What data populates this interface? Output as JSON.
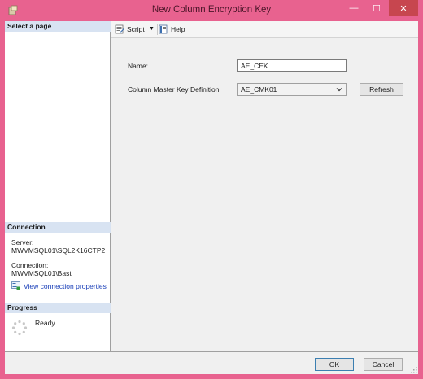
{
  "window": {
    "title": "New Column Encryption Key",
    "minimize_glyph": "—",
    "maximize_glyph": "☐",
    "close_glyph": "✕"
  },
  "left": {
    "select_page_label": "Select a page",
    "connection_label": "Connection",
    "server_label": "Server:",
    "server_value": "MWVMSQL01\\SQL2K16CTP2",
    "connection_field_label": "Connection:",
    "connection_value": "MWVMSQL01\\Bast",
    "view_properties_link": "View connection properties",
    "progress_label": "Progress",
    "progress_status": "Ready"
  },
  "toolbar": {
    "script_label": "Script",
    "dropdown_glyph": "▼",
    "help_label": "Help"
  },
  "form": {
    "name_label": "Name:",
    "name_value": "AE_CEK",
    "cmk_label": "Column Master Key Definition:",
    "cmk_selected": "AE_CMK01",
    "refresh_label": "Refresh"
  },
  "footer": {
    "ok_label": "OK",
    "cancel_label": "Cancel"
  },
  "colors": {
    "titlebar": "#e8628f",
    "close_button": "#c7464f",
    "section_header": "#d8e3f2",
    "link": "#1a3fb8"
  },
  "icons": {
    "app": "app-icon",
    "script": "script-icon",
    "help": "help-icon",
    "connection": "connection-properties-icon",
    "progress": "progress-spinner-icon",
    "dropdown": "chevron-down-icon"
  }
}
